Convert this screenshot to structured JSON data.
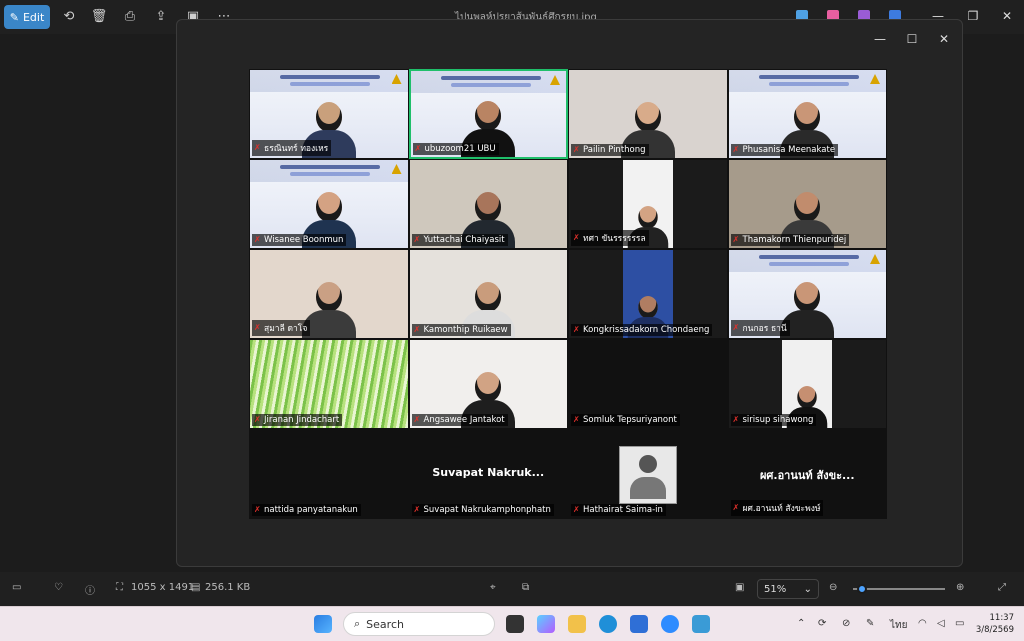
{
  "toolbar": {
    "edit_label": "Edit",
    "file_title": "ไปนพลห์ปรยาส้นพันธ์ศึกรยบ.jpg"
  },
  "gallery": {
    "tiles": [
      {
        "name": "ธรณินทร์ ทองเหร",
        "kind": "banner",
        "skin": "#c9a07c",
        "shirt": "#2e3b5c"
      },
      {
        "name": "ubuzoom21 UBU",
        "kind": "banner",
        "skin": "#b98463",
        "shirt": "#111111",
        "active": true
      },
      {
        "name": "Pailin Pinthong",
        "kind": "room",
        "bg": "#d9d3cf",
        "skin": "#d8ab8a",
        "shirt": "#333333"
      },
      {
        "name": "Phusanisa Meenakate",
        "kind": "banner",
        "skin": "#c99677",
        "shirt": "#2a2a2a"
      },
      {
        "name": "Wisanee Boonmun",
        "kind": "banner",
        "skin": "#d4a283",
        "shirt": "#1f3350"
      },
      {
        "name": "Yuttachai Chaiyasit",
        "kind": "room",
        "bg": "#cfc8bd",
        "skin": "#a8755b",
        "shirt": "#22282f"
      },
      {
        "name": "ทศา ขันรรรรรรล",
        "kind": "portrait",
        "bg": "#f2f2f2",
        "skin": "#d3a383",
        "shirt": "#222222"
      },
      {
        "name": "Thamakorn Thienpuridej",
        "kind": "room",
        "bg": "#a69b8b",
        "skin": "#c18c6d",
        "shirt": "#3a3a3a"
      },
      {
        "name": "สุมาลี ดาโจ",
        "kind": "room",
        "bg": "#e3d7cc",
        "skin": "#caa084",
        "shirt": "#3b3b3b"
      },
      {
        "name": "Kamonthip Ruikaew",
        "kind": "room",
        "bg": "#e5e1dc",
        "skin": "#c99c7c",
        "shirt": "#dddddd"
      },
      {
        "name": "Kongkrissadakorn Chondaeng",
        "kind": "portrait",
        "bg": "#2d4fa3",
        "skin": "#b07d62",
        "shirt": "#1d2f63"
      },
      {
        "name": "กนกอร ธานี",
        "kind": "banner",
        "skin": "#c99677",
        "shirt": "#222222"
      },
      {
        "name": "Jiranan Jindachart",
        "kind": "grass"
      },
      {
        "name": "Angsawee Jantakot",
        "kind": "room",
        "bg": "#f1efed",
        "skin": "#d1a384",
        "shirt": "#1e1e1e"
      },
      {
        "name": "Somluk Tepsuriyanont",
        "kind": "black"
      },
      {
        "name": "sirisup sihawong",
        "kind": "portrait",
        "bg": "#f0f0f0",
        "skin": "#c68f71",
        "shirt": "#111111"
      },
      {
        "name": "nattida panyatanakun",
        "kind": "black"
      },
      {
        "name": "Suvapat Nakrukamphonphatn",
        "kind": "text",
        "label": "Suvapat  Nakruk..."
      },
      {
        "name": "Hathairat Saima-in",
        "kind": "avatar"
      },
      {
        "name": "ผศ.อานนท์ สังขะพงษ์",
        "kind": "text",
        "label": "ผศ.อานนท์ สังขะ..."
      }
    ]
  },
  "bottombar": {
    "dimensions": "1055 x 1491",
    "file_size": "256.1 KB",
    "zoom": "51%"
  },
  "taskbar": {
    "search_placeholder": "Search",
    "lang": "ไทย",
    "time": "11:37",
    "date": "3/8/2569"
  },
  "colors": {
    "accent": "#3a86c8",
    "active_speaker": "#1fbf6a",
    "muted_mic": "#e0302b"
  }
}
